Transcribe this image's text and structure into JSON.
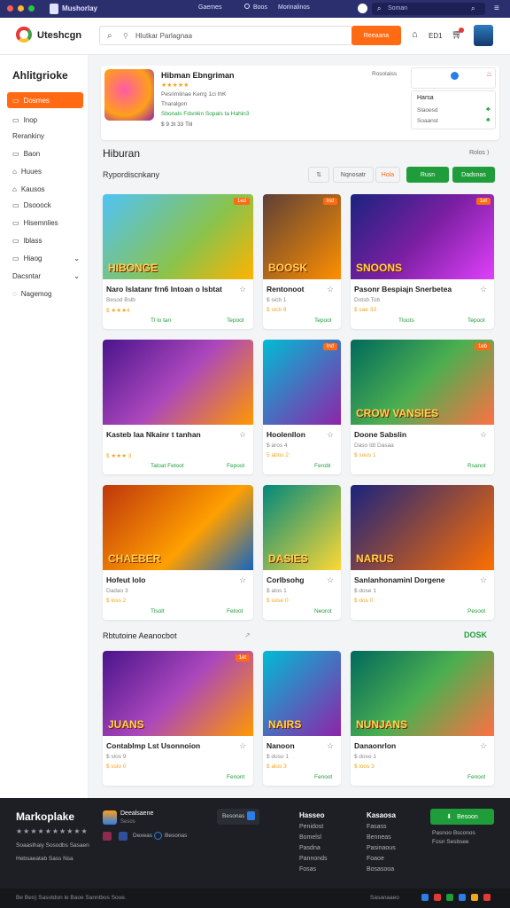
{
  "topbar": {
    "app_name": "Mushorlay",
    "links": [
      "Gaemes",
      "Boos",
      "Morinalinos"
    ],
    "search_placeholder": "Soman"
  },
  "header": {
    "brand": "Uteshcgn",
    "search_text": "Hlutkar Parlagnaa",
    "search_button": "Reeaana",
    "badge": "ED1"
  },
  "sidebar": {
    "title": "Ahlitgrioke",
    "items": [
      "Dosmes",
      "Inop",
      "Rerankiny",
      "Baon",
      "Huues",
      "Kausos",
      "Dsooock",
      "Hisemnlies",
      "Iblass",
      "Hiaog",
      "Dacsntar",
      "Nagemog"
    ]
  },
  "featured": {
    "title": "Hibman Ebngriman",
    "stars": "★★★★★",
    "lines": [
      "Pesrimlinae Kerrg 1ci IhK",
      "Tharalgon"
    ],
    "tags": "Sbonals Fdsnkin Sopals ta Hahin3",
    "meta": "$ 9 3t 33 Tlil",
    "side_title": "Rosolaiss",
    "panel": [
      "Harsa",
      "Slaoesd",
      "Soaanst"
    ]
  },
  "section1": {
    "title": "Hiburan",
    "more": "Rolos ⟩",
    "subtitle": "Rypordiscnkany",
    "filters": [
      "Nqnosatr",
      "Hola"
    ],
    "btn1": "Rusn",
    "btn2": "Dadsnas"
  },
  "games": [
    {
      "title": "Naro Islatanr frn6 Intoan o Isbtat",
      "sub": "Besod Bslb",
      "rating": "$ ★★★4",
      "meta": "Tl lo tan",
      "price": "Tepoot",
      "badge": "1ed",
      "art": "HIBONGE"
    },
    {
      "title": "Rentonoot",
      "sub": "$ sicb 1",
      "rating": "$ sicb 9",
      "meta": "",
      "price": "Tepoot",
      "badge": "Ind",
      "art": "BOOSK"
    },
    {
      "title": "Pasonr Bespiajn Snerbetea",
      "sub": "Dotsb Tob",
      "rating": "$ sae 33",
      "meta": "Tloots",
      "price": "Tepoot",
      "badge": "1et",
      "art": "SNOONS"
    },
    {
      "title": "Kasteb Iaa Nkainr t tanhan",
      "sub": "",
      "rating": "$ ★★★ 3",
      "meta": "Taloat Fetoot",
      "price": "Fepoot",
      "badge": "",
      "art": ""
    },
    {
      "title": "Hoolenllon",
      "sub": "$ aros 4",
      "rating": "5 abos 2",
      "meta": "",
      "price": "Ferobl",
      "badge": "Ind",
      "art": ""
    },
    {
      "title": "Doone Sabslin",
      "sub": "Daso Idt Dasaa",
      "rating": "$ sous 1",
      "meta": "",
      "price": "Rsanot",
      "badge": "1eb",
      "art": "CROW VANSIES"
    },
    {
      "title": "Hofeut lolo",
      "sub": "Dadao 3",
      "rating": "$ loss 2",
      "meta": "Tlsolt",
      "price": "Fetoot",
      "badge": "",
      "art": "CHAEBER"
    },
    {
      "title": "Corlbsohg",
      "sub": "$ alos 1",
      "rating": "$ sose 0",
      "meta": "",
      "price": "Neorot",
      "badge": "",
      "art": "DASIES"
    },
    {
      "title": "Sanlanhonaminl Dorgene",
      "sub": "$ dose 1",
      "rating": "$ dos 0",
      "meta": "",
      "price": "Pesoot",
      "badge": "",
      "art": "NARUS"
    }
  ],
  "section2": {
    "title": "Rbtutoine Aeanocbot",
    "more": "DOSK"
  },
  "games2": [
    {
      "title": "Contablmp Lst Usonnoion",
      "sub": "$ slos 9",
      "rating": "$ sslo 0",
      "price": "Fenont",
      "badge": "1et",
      "art": "JUANS"
    },
    {
      "title": "Nanoon",
      "sub": "$ doso 1",
      "rating": "$ alos 3",
      "price": "Fenoot",
      "badge": "",
      "art": "NAIRS"
    },
    {
      "title": "Danaonrlon",
      "sub": "$ doso 1",
      "rating": "$ loos 3",
      "price": "Fenoot",
      "badge": "",
      "art": "NUNJANS"
    }
  ],
  "footer": {
    "brand": "Markoplake",
    "stars": "★★★★★★★★★★",
    "text1": "Soaaslhaiy Sosodbs Sasaen",
    "text2": "Hebsaeatab Sass Nsa",
    "app_title": "Deealsaene",
    "app_sub": "Sesos",
    "app_btn": "Dexeas",
    "social": "Besonas",
    "col1_title": "Hasseo",
    "col1": [
      "Penidost",
      "Bomelsl",
      "Pasdna",
      "Pannonds",
      "Fosas"
    ],
    "col2_title": "Kasaosa",
    "col2": [
      "Fasass",
      "Benneas",
      "Pasinaous",
      "Foaoe",
      "Bosasooa"
    ],
    "btn": "Besoon",
    "right_lines": [
      "Pasnoo Bsconos",
      "Fosn Sesbsee"
    ],
    "copyright": "Be Beo) Sasotdon le Baoe Sanntbos Sooe.",
    "bottom_right": "Sasanaaeo"
  },
  "colors": {
    "accent": "#ff6a13",
    "green": "#1f9d3a",
    "topbar": "#2b2f6e"
  }
}
